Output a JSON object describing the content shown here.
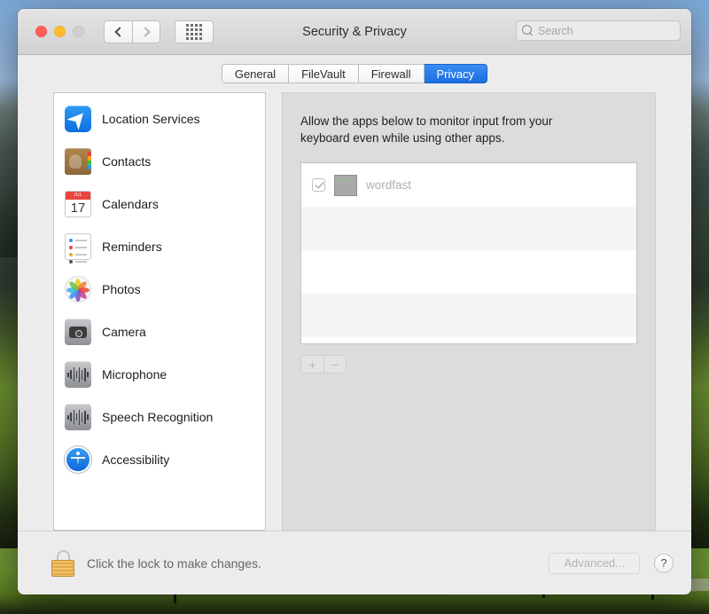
{
  "window": {
    "title": "Security & Privacy",
    "traffic_lights": [
      "close",
      "minimize",
      "zoom"
    ],
    "nav": {
      "back_icon": "chevron-left-icon",
      "forward_icon": "chevron-right-icon",
      "grid_icon": "show-all-grid-icon"
    },
    "search": {
      "placeholder": "Search",
      "value": "",
      "icon": "search-icon"
    }
  },
  "tabs": [
    {
      "label": "General",
      "active": false
    },
    {
      "label": "FileVault",
      "active": false
    },
    {
      "label": "Firewall",
      "active": false
    },
    {
      "label": "Privacy",
      "active": true
    }
  ],
  "sidebar": {
    "items": [
      {
        "label": "Location Services",
        "icon": "location-services-icon"
      },
      {
        "label": "Contacts",
        "icon": "contacts-icon"
      },
      {
        "label": "Calendars",
        "icon": "calendars-icon",
        "month": "JUL",
        "day": "17"
      },
      {
        "label": "Reminders",
        "icon": "reminders-icon"
      },
      {
        "label": "Photos",
        "icon": "photos-icon"
      },
      {
        "label": "Camera",
        "icon": "camera-icon"
      },
      {
        "label": "Microphone",
        "icon": "microphone-icon"
      },
      {
        "label": "Speech Recognition",
        "icon": "speech-recognition-icon"
      },
      {
        "label": "Accessibility",
        "icon": "accessibility-icon"
      }
    ]
  },
  "panel": {
    "description": "Allow the apps below to monitor input from your keyboard even while using other apps.",
    "apps": [
      {
        "name": "wordfast",
        "checked": true,
        "icon_label": "exec"
      }
    ],
    "add_button_label": "+",
    "remove_button_label": "−"
  },
  "footer": {
    "lock_icon": "lock-closed-icon",
    "lock_text": "Click the lock to make changes.",
    "advanced_label": "Advanced...",
    "help_label": "?"
  },
  "colors": {
    "accent": "#1a6fe0",
    "window_bg": "#ececec",
    "panel_bg": "#dcdcdc",
    "lock_gold": "#e0a849"
  }
}
